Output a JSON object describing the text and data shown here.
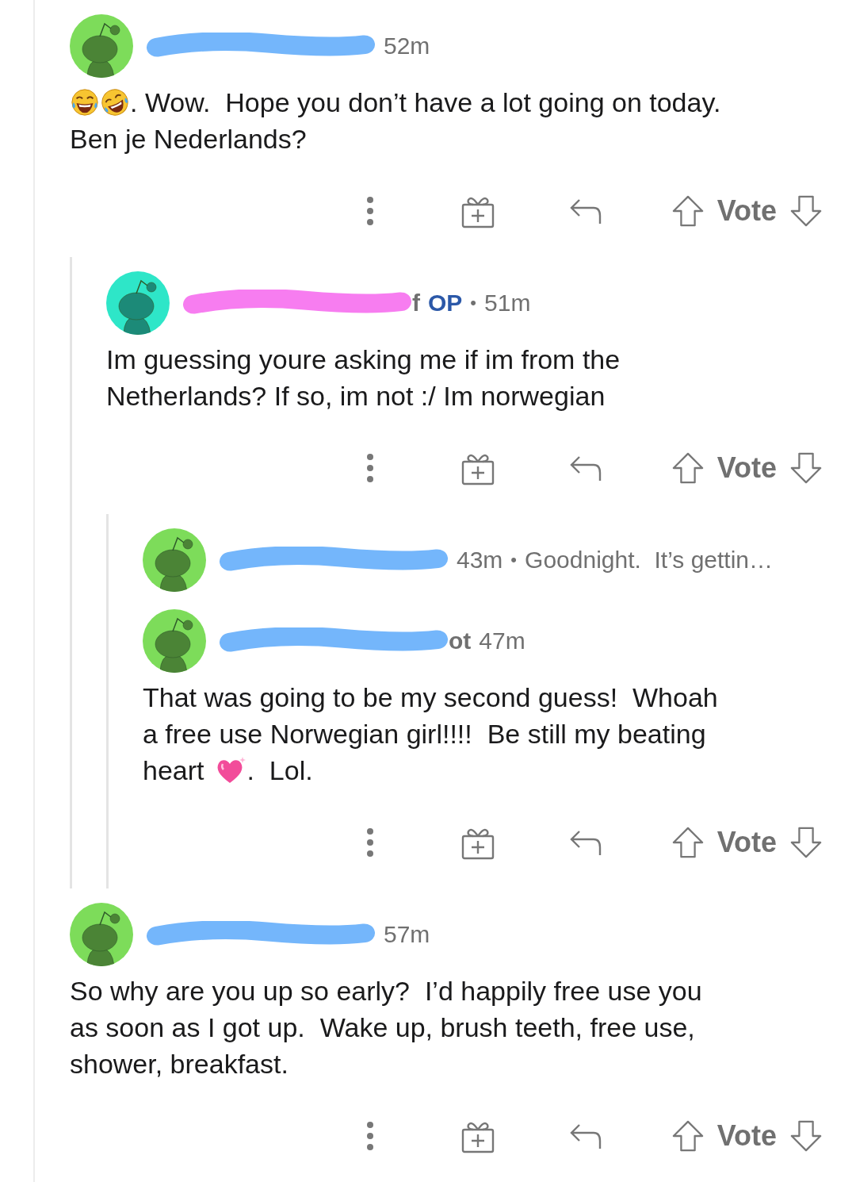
{
  "comments": [
    {
      "avatar": {
        "color": "#7ddc5a"
      },
      "redaction": {
        "color": "#74b6fb"
      },
      "header": [
        {
          "kind": "time",
          "text": "52m"
        }
      ],
      "collapsed": false,
      "body": [
        [
          {
            "kind": "laugh_emoji"
          },
          {
            "kind": "rofl_emoji"
          },
          {
            "kind": "text",
            "text": ". Wow.  Hope you don’t have a lot going on today."
          }
        ],
        [
          {
            "kind": "text",
            "text": "Ben je Nederlands?"
          }
        ]
      ],
      "vote_label": "Vote",
      "children": [
        {
          "avatar": {
            "color": "#2ee6c8"
          },
          "redaction": {
            "color": "#f77df0"
          },
          "header": [
            {
              "kind": "name",
              "text": "f"
            },
            {
              "kind": "badge",
              "text": "OP"
            },
            {
              "kind": "separator",
              "text": "•"
            },
            {
              "kind": "time",
              "text": "51m"
            }
          ],
          "collapsed": false,
          "body": [
            [
              {
                "kind": "text",
                "text": "Im guessing youre asking me if im from the"
              }
            ],
            [
              {
                "kind": "text",
                "text": "Netherlands? If so, im not :/ Im norwegian"
              }
            ]
          ],
          "vote_label": "Vote",
          "children": [
            {
              "avatar": {
                "color": "#7ddc5a"
              },
              "redaction": {
                "color": "#74b6fb"
              },
              "header": [
                {
                  "kind": "time",
                  "text": "43m"
                },
                {
                  "kind": "separator",
                  "text": "•"
                },
                {
                  "kind": "preview",
                  "text": "Goodnight.  It’s gettin…"
                }
              ],
              "collapsed": true
            },
            {
              "avatar": {
                "color": "#7ddc5a"
              },
              "redaction": {
                "color": "#74b6fb"
              },
              "header": [
                {
                  "kind": "name",
                  "text": "ot"
                },
                {
                  "kind": "time",
                  "text": "47m"
                }
              ],
              "collapsed": false,
              "body": [
                [
                  {
                    "kind": "text",
                    "text": "That was going to be my second guess!  Whoah"
                  }
                ],
                [
                  {
                    "kind": "text",
                    "text": "a free use Norwegian girl!!!!  Be still my beating"
                  }
                ],
                [
                  {
                    "kind": "text",
                    "text": "heart"
                  },
                  {
                    "kind": "heart_emoji"
                  },
                  {
                    "kind": "text",
                    "text": ".  Lol."
                  }
                ]
              ],
              "vote_label": "Vote"
            }
          ]
        }
      ]
    },
    {
      "avatar": {
        "color": "#7ddc5a"
      },
      "redaction": {
        "color": "#74b6fb"
      },
      "header": [
        {
          "kind": "time",
          "text": "57m"
        }
      ],
      "collapsed": false,
      "body": [
        [
          {
            "kind": "text",
            "text": "So why are you up so early?  I’d happily free use you"
          }
        ],
        [
          {
            "kind": "text",
            "text": "as soon as I got up.  Wake up, brush teeth, free use,"
          }
        ],
        [
          {
            "kind": "text",
            "text": "shower, breakfast."
          }
        ]
      ],
      "vote_label": "Vote"
    }
  ]
}
